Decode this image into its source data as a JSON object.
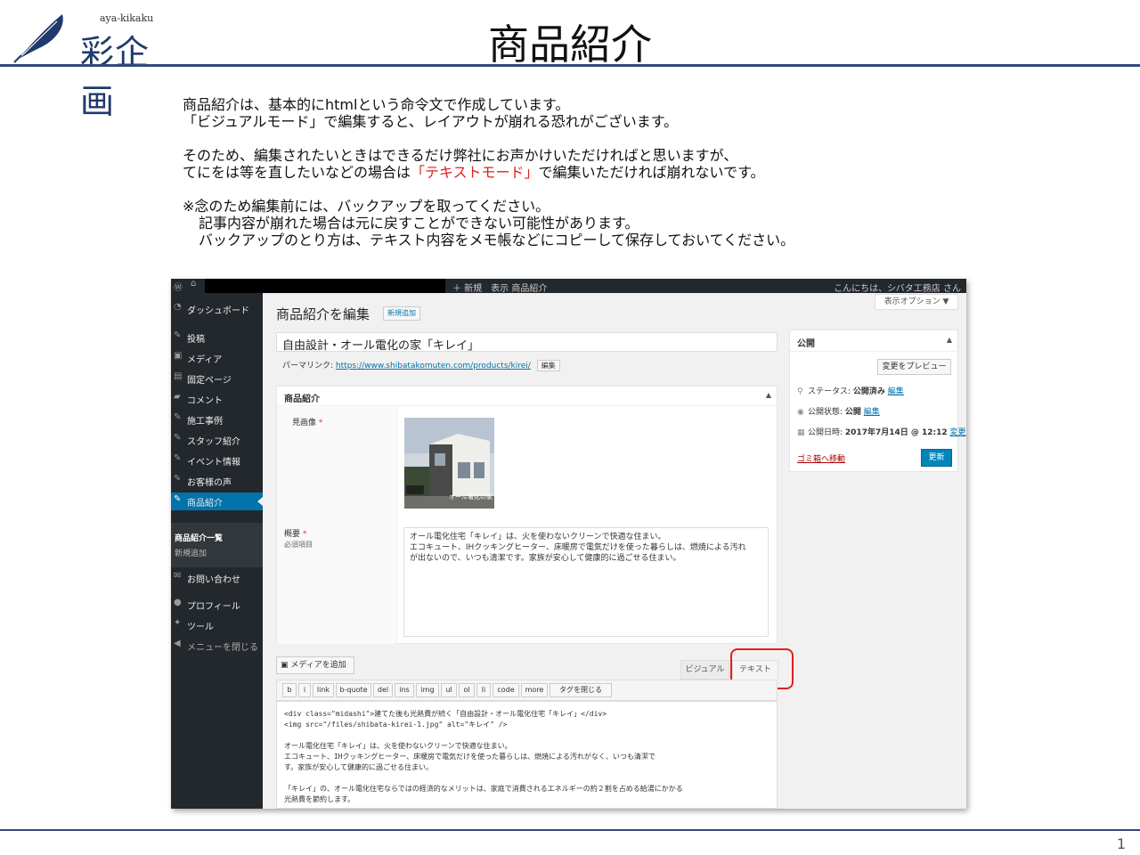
{
  "slide": {
    "logo_sub": "aya-kikaku",
    "logo_main": "彩企画",
    "title": "商品紹介",
    "page_number": "1"
  },
  "intro": {
    "l1": "商品紹介は、基本的にhtmlという命令文で作成しています。",
    "l2": "「ビジュアルモード」で編集すると、レイアウトが崩れる恐れがございます。",
    "l3": "そのため、編集されたいときはできるだけ弊社にお声かけいただければと思いますが、",
    "l4a": "てにをは等を直したいなどの場合は",
    "l4b": "「テキストモード」",
    "l4c": "で編集いただければ崩れないです。",
    "l5": "※念のため編集前には、バックアップを取ってください。",
    "l6": "記事内容が崩れた場合は元に戻すことができない可能性があります。",
    "l7": "バックアップのとり方は、テキスト内容をメモ帳などにコピーして保存しておいてください。"
  },
  "colors": {
    "accent_red": "#e0201e",
    "wp_blue": "#0073aa",
    "rule_navy": "#2f4a7a"
  },
  "wp": {
    "adminbar": {
      "new": "＋ 新規　表示 商品紹介",
      "howdy": "こんにちは、シバタ工務店 さん"
    },
    "menu": [
      {
        "label": "ダッシュボード",
        "icon": "dashboard-icon"
      },
      {
        "label": "投稿",
        "icon": "pin-icon"
      },
      {
        "label": "メディア",
        "icon": "media-icon"
      },
      {
        "label": "固定ページ",
        "icon": "page-icon"
      },
      {
        "label": "コメント",
        "icon": "comment-icon"
      },
      {
        "label": "施工事例",
        "icon": "pin-icon"
      },
      {
        "label": "スタッフ紹介",
        "icon": "pin-icon"
      },
      {
        "label": "イベント情報",
        "icon": "pin-icon"
      },
      {
        "label": "お客様の声",
        "icon": "pin-icon"
      },
      {
        "label": "商品紹介",
        "icon": "pin-icon"
      },
      {
        "label": "お問い合わせ",
        "icon": "mail-icon"
      },
      {
        "label": "プロフィール",
        "icon": "user-icon"
      },
      {
        "label": "ツール",
        "icon": "wrench-icon"
      },
      {
        "label": "メニューを閉じる",
        "icon": "collapse-icon"
      }
    ],
    "submenu": {
      "list": "商品紹介一覧",
      "add": "新規追加"
    },
    "screen_options": "表示オプション ▼",
    "heading": "商品紹介を編集",
    "add_new": "新規追加",
    "post_title": "自由設計・オール電化の家「キレイ」",
    "permalink_label": "パーマリンク:",
    "permalink_url": "https://www.shibatakomuten.com/products/kirei/",
    "permalink_edit": "編集",
    "acf": {
      "title": "商品紹介",
      "image_label": "見画像",
      "summary_label": "概要",
      "summary_sub": "必須項目",
      "image_caption": "オール電化の家",
      "summary_text": "オール電化住宅「キレイ」は、火を使わないクリーンで快適な住まい。\nエコキュート、IHクッキングヒーター、床暖房で電気だけを使った暮らしは、燃焼による汚れ\nが出ないので、いつも清潔です。家族が安心して健康的に過ごせる住まい。"
    },
    "publish": {
      "title": "公開",
      "preview": "変更をプレビュー",
      "status_label": "ステータス: ",
      "status_value": "公開済み",
      "status_edit": "編集",
      "visibility_label": "公開状態: ",
      "visibility_value": "公開",
      "visibility_edit": "編集",
      "date_label": "公開日時: ",
      "date_value": "2017年7月14日 @ 12:12",
      "date_edit": "変更",
      "trash": "ゴミ箱へ移動",
      "update": "更新"
    },
    "media_button": "メディアを追加",
    "tab_visual": "ビジュアル",
    "tab_text": "テキスト",
    "quicktags": [
      "b",
      "i",
      "link",
      "b-quote",
      "del",
      "ins",
      "img",
      "ul",
      "ol",
      "li",
      "code",
      "more",
      "タグを閉じる"
    ],
    "editor_lines": [
      "<div class=\"midashi\">建てた後も光熱費が続く「自由設計・オール電化住宅「キレイ」</div>",
      "<img src=\"/files/shibata-kirei-1.jpg\" alt=\"キレイ\" />",
      "",
      "オール電化住宅「キレイ」は、火を使わないクリーンで快適な住まい。",
      "エコキュート、IHクッキングヒーター、床暖房で電気だけを使った暮らしは、燃焼による汚れがなく、いつも清潔で",
      "す。家族が安心して健康的に過ごせる住まい。",
      "",
      "「キレイ」の、オール電化住宅ならではの経済的なメリットは、家庭で消費されるエネルギーの約２割を占める給湯にかかる",
      "光熱費を節約します。"
    ]
  }
}
